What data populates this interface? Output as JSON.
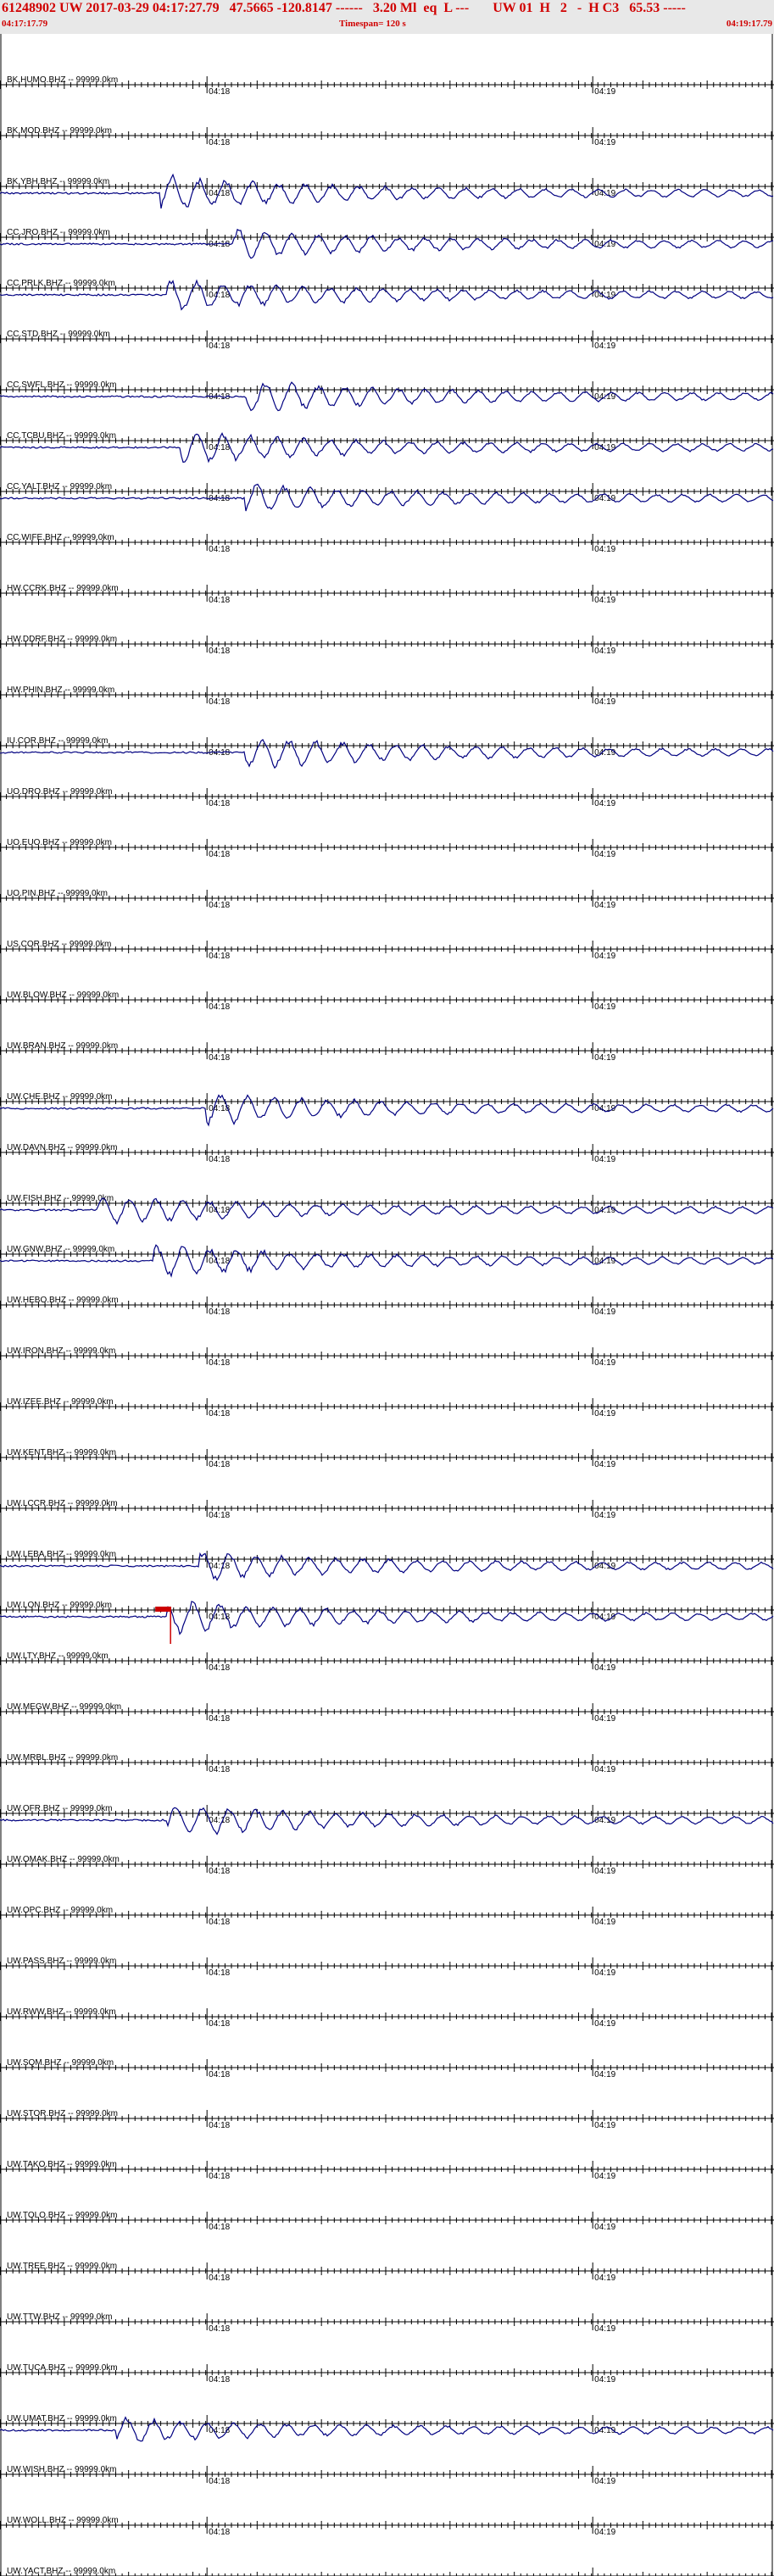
{
  "header": {
    "line1": "61248902 UW 2017-03-29 04:17:27.79   47.5665 -120.8147 ------   3.20 Ml  eq  L ---       UW 01  H   2   -  H C3   65.53 -----",
    "start_time": "04:17:17.79",
    "timespan": "Timespan= 120 s",
    "end_time": "04:19:17.79"
  },
  "colors": {
    "header_text": "#d00000",
    "trace": "#000080",
    "baseline": "#000000",
    "label": "#000000",
    "pick": "#cc0000",
    "header_bg": "#e8e8e8"
  },
  "time_ticks": {
    "first": "04:18",
    "second": "04:19"
  },
  "chart_data": {
    "type": "line",
    "title": "61248902 UW 2017-03-29 04:17:27.79",
    "x_range_s": [
      0,
      120
    ],
    "channels": [
      {
        "label": "BK.HUMO.BHZ -- 99999.0km",
        "has_signal": false,
        "amplitude": 0,
        "onset_s": 0
      },
      {
        "label": "BK.MOD.BHZ -- 99999.0km",
        "has_signal": false,
        "amplitude": 0,
        "onset_s": 0
      },
      {
        "label": "BK.YBH.BHZ -- 99999.0km",
        "has_signal": true,
        "amplitude": 18,
        "onset_s": 25
      },
      {
        "label": "CC.JRO.BHZ -- 99999.0km",
        "has_signal": true,
        "amplitude": 14,
        "onset_s": 36
      },
      {
        "label": "CC.PRLK.BHZ -- 99999.0km",
        "has_signal": true,
        "amplitude": 16,
        "onset_s": 26
      },
      {
        "label": "CC.STD.BHZ -- 99999.0km",
        "has_signal": false,
        "amplitude": 0,
        "onset_s": 0
      },
      {
        "label": "CC.SWFL.BHZ -- 99999.0km",
        "has_signal": true,
        "amplitude": 16,
        "onset_s": 38
      },
      {
        "label": "CC.TCBU.BHZ -- 99999.0km",
        "has_signal": true,
        "amplitude": 16,
        "onset_s": 28
      },
      {
        "label": "CC.YALT.BHZ -- 99999.0km",
        "has_signal": true,
        "amplitude": 14,
        "onset_s": 38
      },
      {
        "label": "CC.WIFE.BHZ -- 99999.0km",
        "has_signal": false,
        "amplitude": 0,
        "onset_s": 0
      },
      {
        "label": "HW.CCRK.BHZ -- 99999.0km",
        "has_signal": false,
        "amplitude": 0,
        "onset_s": 0
      },
      {
        "label": "HW.DDRF.BHZ -- 99999.0km",
        "has_signal": false,
        "amplitude": 0,
        "onset_s": 0
      },
      {
        "label": "HW.PHIN.BHZ -- 99999.0km",
        "has_signal": false,
        "amplitude": 0,
        "onset_s": 0
      },
      {
        "label": "IU.COR.BHZ -- 99999.0km",
        "has_signal": true,
        "amplitude": 16,
        "onset_s": 38
      },
      {
        "label": "UO.DRO.BHZ -- 99999.0km",
        "has_signal": false,
        "amplitude": 0,
        "onset_s": 0
      },
      {
        "label": "UO.EUO.BHZ -- 99999.0km",
        "has_signal": false,
        "amplitude": 0,
        "onset_s": 0
      },
      {
        "label": "UO.PIN.BHZ -- 99999.0km",
        "has_signal": false,
        "amplitude": 0,
        "onset_s": 0
      },
      {
        "label": "US.COR.BHZ -- 99999.0km",
        "has_signal": false,
        "amplitude": 0,
        "onset_s": 0
      },
      {
        "label": "UW.BLOW.BHZ -- 99999.0km",
        "has_signal": false,
        "amplitude": 0,
        "onset_s": 0
      },
      {
        "label": "UW.BRAN.BHZ -- 99999.0km",
        "has_signal": false,
        "amplitude": 0,
        "onset_s": 0
      },
      {
        "label": "UW.CHE.BHZ -- 99999.0km",
        "has_signal": true,
        "amplitude": 16,
        "onset_s": 32
      },
      {
        "label": "UW.DAVN.BHZ -- 99999.0km",
        "has_signal": false,
        "amplitude": 0,
        "onset_s": 0
      },
      {
        "label": "UW.FISH.BHZ -- 99999.0km",
        "has_signal": true,
        "amplitude": 14,
        "onset_s": 15
      },
      {
        "label": "UW.GNW.BHZ -- 99999.0km",
        "has_signal": true,
        "amplitude": 16,
        "onset_s": 24
      },
      {
        "label": "UW.HEBO.BHZ -- 99999.0km",
        "has_signal": false,
        "amplitude": 0,
        "onset_s": 0
      },
      {
        "label": "UW.IRON.BHZ -- 99999.0km",
        "has_signal": false,
        "amplitude": 0,
        "onset_s": 0
      },
      {
        "label": "UW.IZEE.BHZ -- 99999.0km",
        "has_signal": false,
        "amplitude": 0,
        "onset_s": 0
      },
      {
        "label": "UW.KENT.BHZ -- 99999.0km",
        "has_signal": false,
        "amplitude": 0,
        "onset_s": 0
      },
      {
        "label": "UW.LCCR.BHZ -- 99999.0km",
        "has_signal": false,
        "amplitude": 0,
        "onset_s": 0
      },
      {
        "label": "UW.LEBA.BHZ -- 99999.0km",
        "has_signal": true,
        "amplitude": 14,
        "onset_s": 31
      },
      {
        "label": "UW.LON.BHZ -- 99999.0km",
        "has_signal": true,
        "amplitude": 16,
        "onset_s": 26,
        "pick": true
      },
      {
        "label": "UW.LTY.BHZ -- 99999.0km",
        "has_signal": false,
        "amplitude": 0,
        "onset_s": 0
      },
      {
        "label": "UW.MEGW.BHZ -- 99999.0km",
        "has_signal": false,
        "amplitude": 0,
        "onset_s": 0
      },
      {
        "label": "UW.MRBL.BHZ -- 99999.0km",
        "has_signal": false,
        "amplitude": 0,
        "onset_s": 0
      },
      {
        "label": "UW.OFR.BHZ -- 99999.0km",
        "has_signal": true,
        "amplitude": 16,
        "onset_s": 26
      },
      {
        "label": "UW.OMAK.BHZ -- 99999.0km",
        "has_signal": false,
        "amplitude": 0,
        "onset_s": 0
      },
      {
        "label": "UW.OPC.BHZ -- 99999.0km",
        "has_signal": false,
        "amplitude": 0,
        "onset_s": 0
      },
      {
        "label": "UW.PASS.BHZ -- 99999.0km",
        "has_signal": false,
        "amplitude": 0,
        "onset_s": 0
      },
      {
        "label": "UW.RWW.BHZ -- 99999.0km",
        "has_signal": false,
        "amplitude": 0,
        "onset_s": 0
      },
      {
        "label": "UW.SQM.BHZ -- 99999.0km",
        "has_signal": false,
        "amplitude": 0,
        "onset_s": 0
      },
      {
        "label": "UW.STOR.BHZ -- 99999.0km",
        "has_signal": false,
        "amplitude": 0,
        "onset_s": 0
      },
      {
        "label": "UW.TAKO.BHZ -- 99999.0km",
        "has_signal": false,
        "amplitude": 0,
        "onset_s": 0
      },
      {
        "label": "UW.TOLO.BHZ -- 99999.0km",
        "has_signal": false,
        "amplitude": 0,
        "onset_s": 0
      },
      {
        "label": "UW.TREE.BHZ -- 99999.0km",
        "has_signal": false,
        "amplitude": 0,
        "onset_s": 0
      },
      {
        "label": "UW.TTW.BHZ -- 99999.0km",
        "has_signal": false,
        "amplitude": 0,
        "onset_s": 0
      },
      {
        "label": "UW.TUCA.BHZ -- 99999.0km",
        "has_signal": false,
        "amplitude": 0,
        "onset_s": 0
      },
      {
        "label": "UW.UMAT.BHZ -- 99999.0km",
        "has_signal": true,
        "amplitude": 12,
        "onset_s": 18
      },
      {
        "label": "UW.WISH.BHZ -- 99999.0km",
        "has_signal": false,
        "amplitude": 0,
        "onset_s": 0
      },
      {
        "label": "UW.WOLL.BHZ -- 99999.0km",
        "has_signal": false,
        "amplitude": 0,
        "onset_s": 0
      },
      {
        "label": "UW.YACT.BHZ -- 99999.0km",
        "has_signal": false,
        "amplitude": 0,
        "onset_s": 0
      }
    ]
  }
}
